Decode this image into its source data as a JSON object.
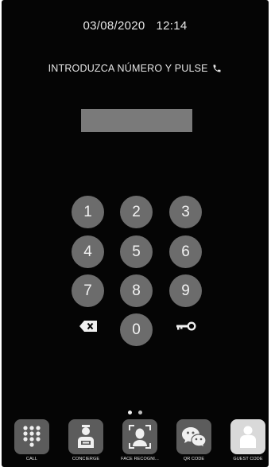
{
  "status": {
    "date": "03/08/2020",
    "time": "12:14"
  },
  "prompt": {
    "text": "INTRODUZCA NÚMERO Y PULSE",
    "icon": "phone-icon"
  },
  "entry": {
    "value": ""
  },
  "keypad": {
    "keys": [
      "1",
      "2",
      "3",
      "4",
      "5",
      "6",
      "7",
      "8",
      "9",
      "0"
    ],
    "backspace_icon": "backspace-icon",
    "key_icon": "key-icon"
  },
  "pager": {
    "pages": 2,
    "active": 1
  },
  "bottom_bar": {
    "items": [
      {
        "label": "CALL",
        "icon": "dialpad-icon"
      },
      {
        "label": "CONCIERGE",
        "icon": "concierge-icon"
      },
      {
        "label": "FACE RECOGNI...",
        "icon": "face-recognition-icon"
      },
      {
        "label": "QR CODE",
        "icon": "chat-icon"
      },
      {
        "label": "GUEST CODE",
        "icon": "guest-icon"
      }
    ]
  },
  "colors": {
    "background": "#050505",
    "key": "#6c6c6c",
    "entry_field": "#7a7a7a",
    "text": "#e6e6e6"
  }
}
